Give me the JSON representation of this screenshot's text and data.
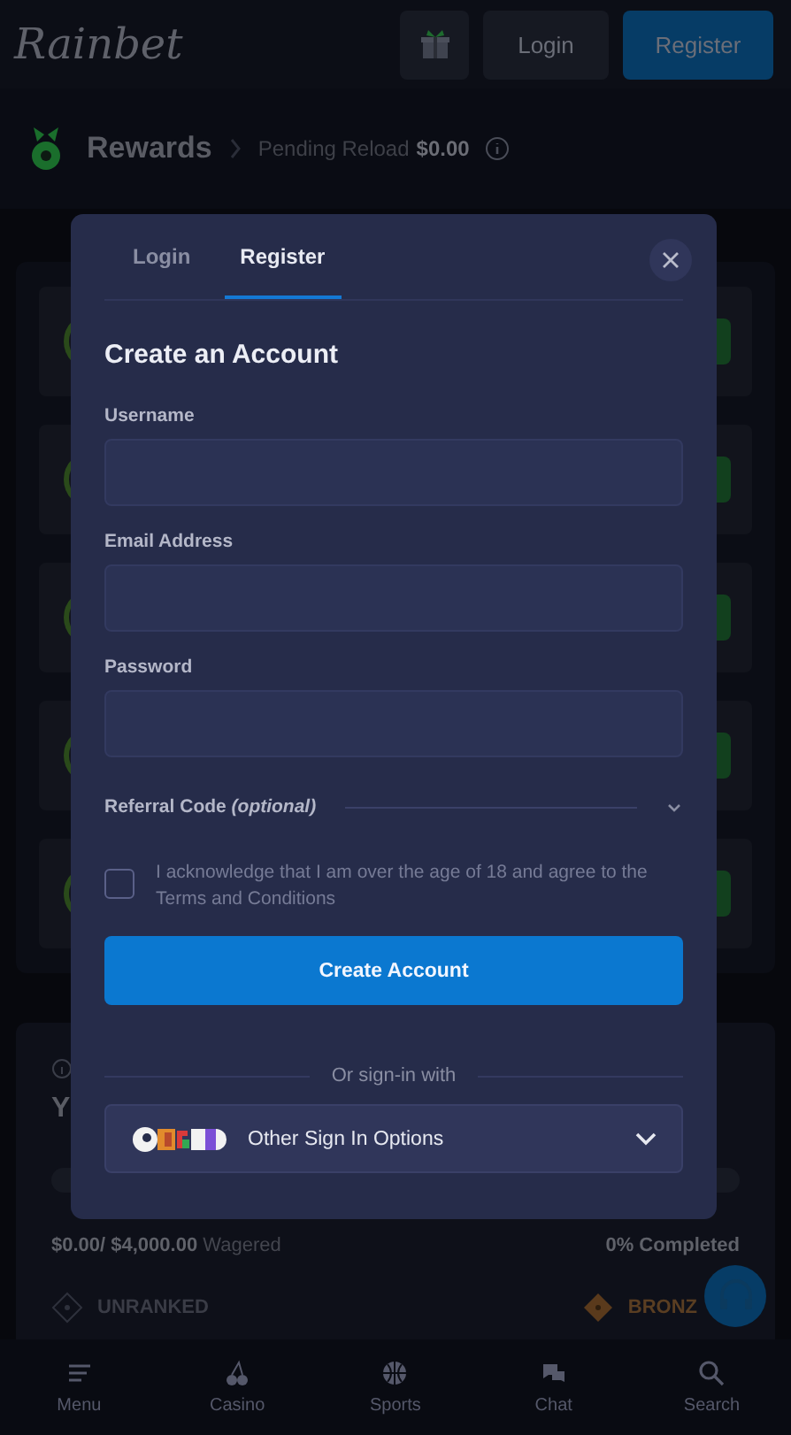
{
  "header": {
    "logo": "Rainbet",
    "login": "Login",
    "register": "Register"
  },
  "rewards": {
    "title": "Rewards",
    "pending_label": "Pending Reload",
    "pending_amount": "$0.00"
  },
  "progress_card": {
    "title": "Y",
    "wagered": "$0.00/",
    "target": "$4,000.00",
    "wagered_label": "Wagered",
    "completed": "0% Completed",
    "level": 0,
    "ranks": [
      {
        "label": "UNRANKED",
        "kind": "unranked"
      },
      {
        "label": "BRONZ",
        "kind": "bronze"
      }
    ]
  },
  "modal": {
    "tabs": [
      {
        "label": "Login",
        "selected": false
      },
      {
        "label": "Register",
        "selected": true
      }
    ],
    "heading": "Create an Account",
    "fields": [
      {
        "label": "Username"
      },
      {
        "label": "Email Address"
      },
      {
        "label": "Password"
      }
    ],
    "referral": {
      "label": "Referral Code *(optional)*",
      "expanded": false
    },
    "consent": {
      "text": "I acknowledge that I am over the age of 18 and agree to the Terms and Conditions",
      "checked": false
    },
    "submit": "Create Account",
    "divider": "Or sign-in with",
    "other_options": "Other Sign In Options"
  },
  "nav": [
    {
      "label": "Menu",
      "kind": "menu"
    },
    {
      "label": "Casino",
      "kind": "casino"
    },
    {
      "label": "Sports",
      "kind": "sports"
    },
    {
      "label": "Chat",
      "kind": "chat"
    },
    {
      "label": "Search",
      "kind": "search"
    }
  ]
}
